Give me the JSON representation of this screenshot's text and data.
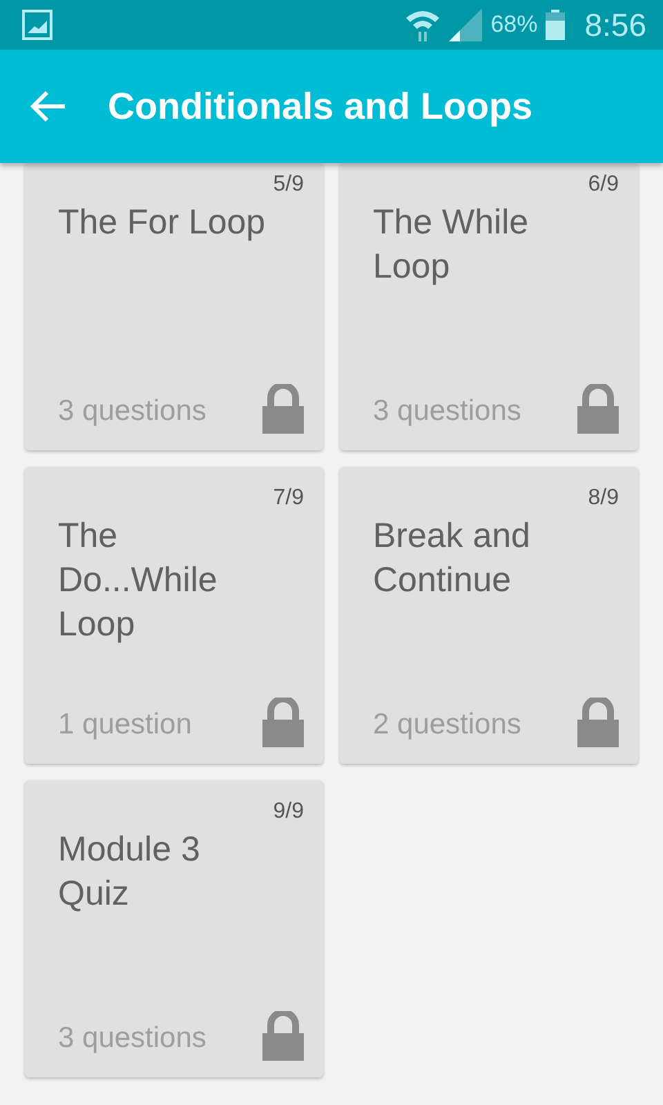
{
  "status_bar": {
    "battery": "68%",
    "time": "8:56"
  },
  "app_bar": {
    "title": "Conditionals and Loops"
  },
  "lessons": [
    {
      "number": "5/9",
      "title": "The For Loop",
      "questions": "3 questions",
      "locked": true
    },
    {
      "number": "6/9",
      "title": "The While Loop",
      "questions": "3 questions",
      "locked": true
    },
    {
      "number": "7/9",
      "title": "The Do...While Loop",
      "questions": "1 question",
      "locked": true
    },
    {
      "number": "8/9",
      "title": "Break and Continue",
      "questions": "2 questions",
      "locked": true
    },
    {
      "number": "9/9",
      "title": "Module 3 Quiz",
      "questions": "3 questions",
      "locked": true
    }
  ]
}
